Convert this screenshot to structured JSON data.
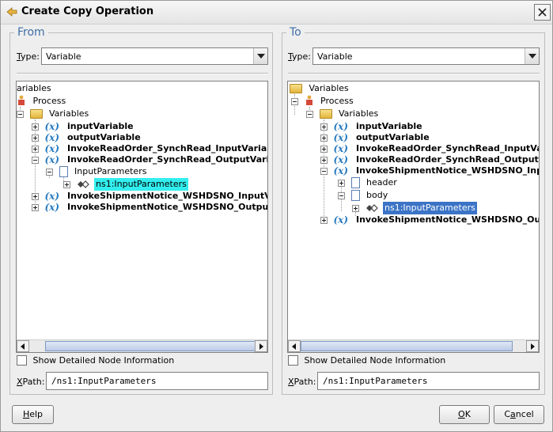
{
  "dialog": {
    "title": "Create Copy Operation",
    "close_label": "X"
  },
  "from": {
    "heading": "From",
    "type_label_key": "T",
    "type_label_rest": "ype:",
    "type_value": "Variable",
    "tree": [
      {
        "label": "ariables",
        "icon": "folder-icon",
        "bold": false
      },
      {
        "label": "Process",
        "icon": "process-icon",
        "bold": false
      },
      {
        "label": "Variables",
        "icon": "folder-icon",
        "bold": false
      },
      {
        "label": "inputVariable",
        "icon": "variable-icon",
        "bold": true
      },
      {
        "label": "outputVariable",
        "icon": "variable-icon",
        "bold": true
      },
      {
        "label": "InvokeReadOrder_SynchRead_InputVariable",
        "icon": "variable-icon",
        "bold": true
      },
      {
        "label": "InvokeReadOrder_SynchRead_OutputVariable",
        "icon": "variable-icon",
        "bold": true
      },
      {
        "label": "InputParameters",
        "icon": "document-icon",
        "bold": false
      },
      {
        "label": "ns1:InputParameters",
        "icon": "element-icon",
        "bold": false,
        "selected": true
      },
      {
        "label": "InvokeShipmentNotice_WSHDSNO_InputVaria",
        "icon": "variable-icon",
        "bold": true
      },
      {
        "label": "InvokeShipmentNotice_WSHDSNO_OutputVari",
        "icon": "variable-icon",
        "bold": true
      }
    ],
    "show_details_label": "Show Detailed Node Information",
    "show_details_checked": false,
    "xpath_label_key": "X",
    "xpath_label_rest": "Path:",
    "xpath_value": "/ns1:InputParameters"
  },
  "to": {
    "heading": "To",
    "type_label_key": "T",
    "type_label_rest": "ype:",
    "type_value": "Variable",
    "tree": [
      {
        "label": "Variables",
        "icon": "folder-icon",
        "bold": false
      },
      {
        "label": "Process",
        "icon": "process-icon",
        "bold": false
      },
      {
        "label": "Variables",
        "icon": "folder-icon",
        "bold": false
      },
      {
        "label": "inputVariable",
        "icon": "variable-icon",
        "bold": true
      },
      {
        "label": "outputVariable",
        "icon": "variable-icon",
        "bold": true
      },
      {
        "label": "InvokeReadOrder_SynchRead_InputVaria",
        "icon": "variable-icon",
        "bold": true
      },
      {
        "label": "InvokeReadOrder_SynchRead_OutputVa",
        "icon": "variable-icon",
        "bold": true
      },
      {
        "label": "InvokeShipmentNotice_WSHDSNO_InputV",
        "icon": "variable-icon",
        "bold": true
      },
      {
        "label": "header",
        "icon": "document-icon",
        "bold": false
      },
      {
        "label": "body",
        "icon": "document-icon",
        "bold": false
      },
      {
        "label": "ns1:InputParameters",
        "icon": "element-icon",
        "bold": false,
        "selected": true
      },
      {
        "label": "InvokeShipmentNotice_WSHDSNO_Outpu",
        "icon": "variable-icon",
        "bold": true
      }
    ],
    "show_details_label": "Show Detailed Node Information",
    "show_details_checked": false,
    "xpath_label_key": "X",
    "xpath_label_rest": "Path:",
    "xpath_value": "/ns1:InputParameters"
  },
  "buttons": {
    "help_key": "H",
    "help_rest": "elp",
    "ok_key": "O",
    "ok_rest": "K",
    "cancel_pre": "C",
    "cancel_key": "a",
    "cancel_rest": "ncel"
  },
  "colors": {
    "heading": "#3f6fa8",
    "selection_from": "#33eeee",
    "selection_to": "#3b74c6",
    "variable_icon": "#2a7cc0"
  }
}
